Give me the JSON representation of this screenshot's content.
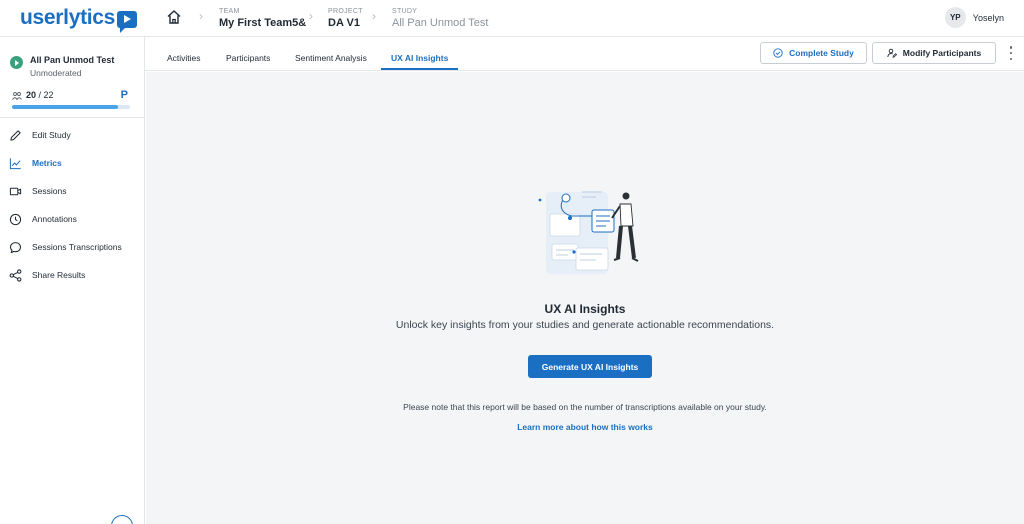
{
  "app": {
    "logo_text": "userlytics"
  },
  "breadcrumb": {
    "team_label": "TEAM",
    "team_value": "My First Team5&",
    "project_label": "PROJECT",
    "project_value": "DA V1",
    "study_label": "STUDY",
    "study_value": "All Pan Unmod Test"
  },
  "user": {
    "initials": "YP",
    "name": "Yoselyn"
  },
  "sidebar": {
    "study_name": "All Pan Unmod Test",
    "study_type": "Unmoderated",
    "participants_done": "20",
    "participants_total": "/ 22",
    "participants_progress_fraction": 0.9,
    "plan_badge": "P",
    "items": [
      {
        "label": "Edit Study",
        "icon": "pencil-icon",
        "active": false
      },
      {
        "label": "Metrics",
        "icon": "chart-line-icon",
        "active": true
      },
      {
        "label": "Sessions",
        "icon": "video-camera-icon",
        "active": false
      },
      {
        "label": "Annotations",
        "icon": "clock-icon",
        "active": false
      },
      {
        "label": "Sessions Transcriptions",
        "icon": "chat-bubble-icon",
        "active": false
      },
      {
        "label": "Share Results",
        "icon": "share-icon",
        "active": false
      }
    ]
  },
  "tabs": [
    {
      "label": "Activities",
      "active": false
    },
    {
      "label": "Participants",
      "active": false
    },
    {
      "label": "Sentiment Analysis",
      "active": false
    },
    {
      "label": "UX AI Insights",
      "active": true
    }
  ],
  "actions": {
    "complete_study": "Complete Study",
    "modify_participants": "Modify Participants"
  },
  "insights": {
    "title": "UX AI Insights",
    "subtitle": "Unlock key insights from your studies and generate actionable recommendations.",
    "generate_button": "Generate UX AI Insights",
    "note": "Please note that this report will be based on the number of transcriptions available on your study.",
    "learn_more": "Learn more about how this works"
  },
  "colors": {
    "brand": "#1b6fc2",
    "status_green": "#3aa17e",
    "main_bg": "#f4f5f7"
  }
}
